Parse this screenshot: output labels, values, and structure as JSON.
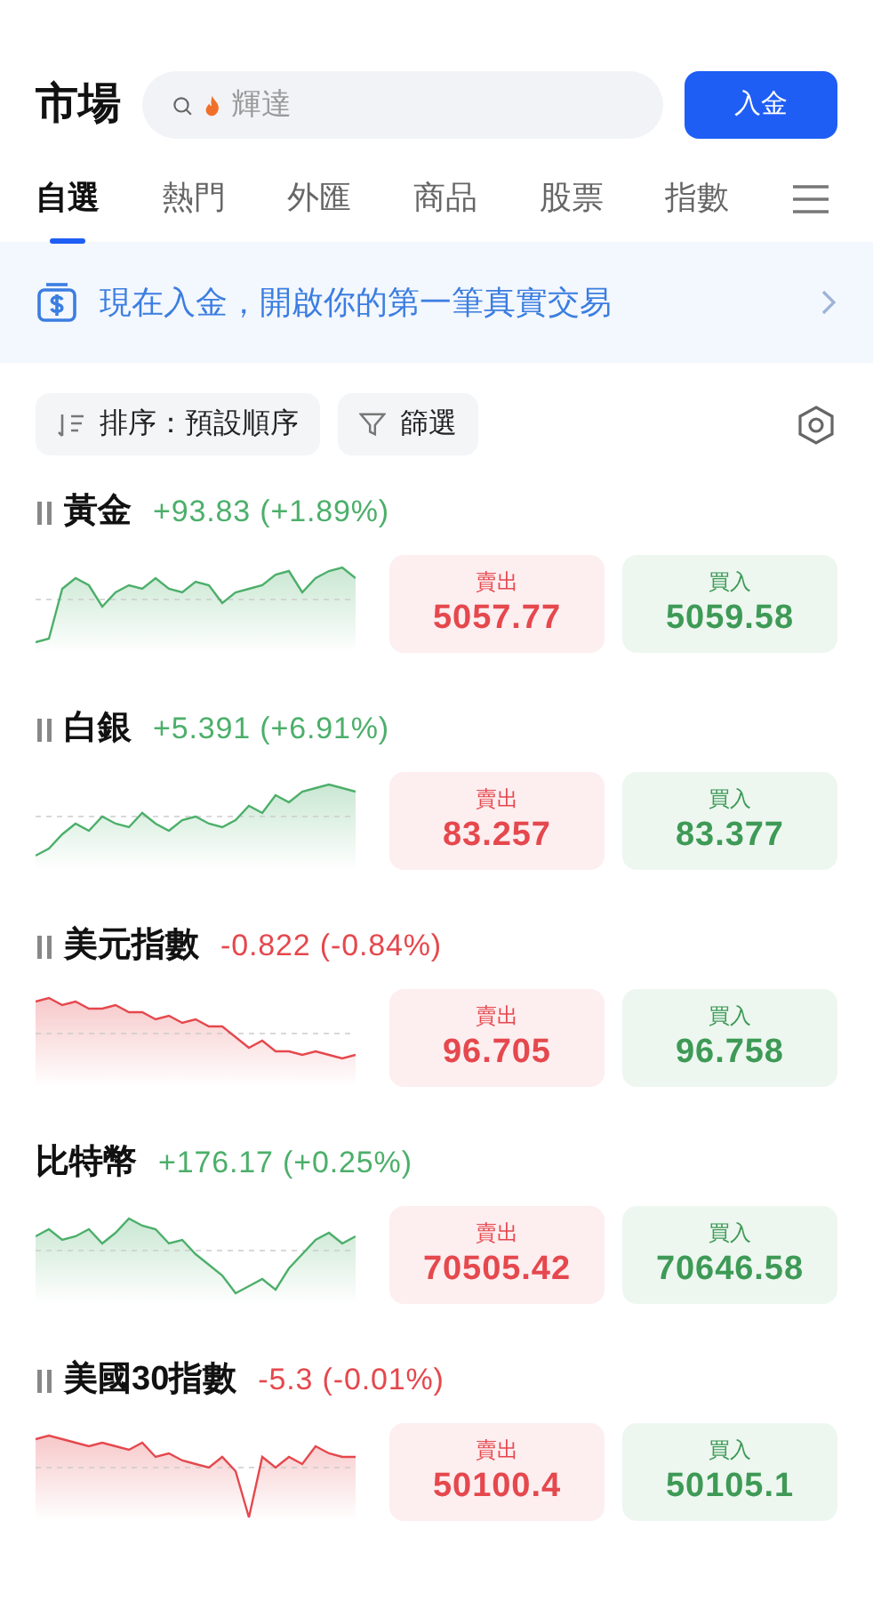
{
  "header": {
    "title": "市場",
    "search": {
      "placeholder": "輝達"
    },
    "deposit_button": "入金"
  },
  "tabs": [
    {
      "label": "自選",
      "selected": true
    },
    {
      "label": "熱門",
      "selected": false
    },
    {
      "label": "外匯",
      "selected": false
    },
    {
      "label": "商品",
      "selected": false
    },
    {
      "label": "股票",
      "selected": false
    },
    {
      "label": "指數",
      "selected": false
    }
  ],
  "banner": {
    "text": "現在入金，開啟你的第一筆真實交易"
  },
  "filters": {
    "sort": "排序：預設順序",
    "filter": "篩選"
  },
  "quotes": [
    {
      "name": "黃金",
      "paused": true,
      "color": "#4caf6a",
      "change": "+93.83 (+1.89%)",
      "sell_label": "賣出",
      "sell": "5057.77",
      "buy_label": "買入",
      "buy": "5059.58"
    },
    {
      "name": "白銀",
      "paused": true,
      "color": "#4caf6a",
      "change": "+5.391 (+6.91%)",
      "sell_label": "賣出",
      "sell": "83.257",
      "buy_label": "買入",
      "buy": "83.377"
    },
    {
      "name": "美元指數",
      "paused": true,
      "color": "#e5484d",
      "change": "-0.822 (-0.84%)",
      "sell_label": "賣出",
      "sell": "96.705",
      "buy_label": "買入",
      "buy": "96.758"
    },
    {
      "name": "比特幣",
      "paused": false,
      "color": "#4caf6a",
      "change": "+176.17 (+0.25%)",
      "sell_label": "賣出",
      "sell": "70505.42",
      "buy_label": "買入",
      "buy": "70646.58"
    },
    {
      "name": "美國30指數",
      "paused": true,
      "color": "#e5484d",
      "change": "-5.3 (-0.01%)",
      "sell_label": "賣出",
      "sell": "50100.4",
      "buy_label": "買入",
      "buy": "50105.1"
    }
  ]
}
